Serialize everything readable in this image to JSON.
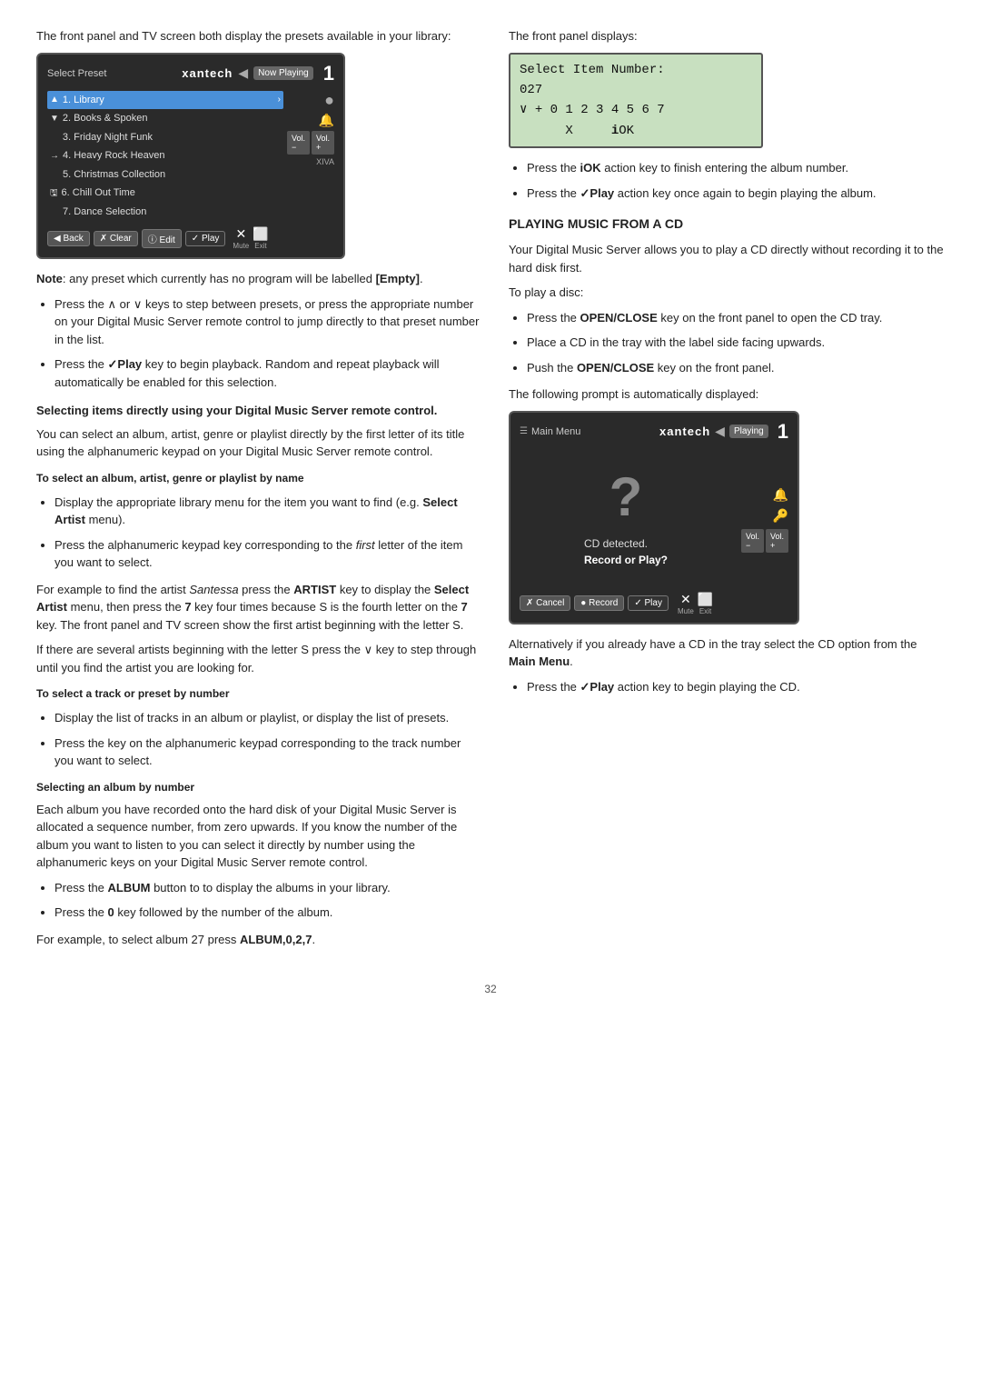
{
  "left_col": {
    "intro_text": "The front panel and TV screen both display the presets available in your library:",
    "screen": {
      "label": "Select Preset",
      "brand": "xantech",
      "now_playing": "Now Playing",
      "big_number": "1",
      "items": [
        {
          "id": 1,
          "name": "Library",
          "selected": true,
          "has_arrow": true,
          "icon": "▲"
        },
        {
          "id": 2,
          "name": "Books & Spoken",
          "selected": false,
          "icon": "▼"
        },
        {
          "id": 3,
          "name": "Friday Night Funk",
          "selected": false,
          "icon": ""
        },
        {
          "id": 4,
          "name": "Heavy Rock Heaven",
          "selected": false,
          "icon": "→"
        },
        {
          "id": 5,
          "name": "Christmas Collection",
          "selected": false,
          "icon": ""
        },
        {
          "id": 6,
          "name": "Chill Out Time",
          "selected": false,
          "icon": "🖫"
        },
        {
          "id": 7,
          "name": "Dance Selection",
          "selected": false,
          "icon": ""
        }
      ],
      "footer_buttons": [
        "◀ Back",
        "✗ Clear",
        "ⓘ Edit",
        "✓ Play"
      ],
      "vol_label1": "Vol.",
      "vol_label2": "Vol.",
      "library_label": "Library",
      "xiva_label": "XIVA",
      "mute_label": "Mute",
      "exit_label": "Exit"
    },
    "note": "Note: any preset which currently has no program will be labelled [Empty].",
    "bullets1": [
      "Press the ∧ or ∨ keys to step between presets, or press the appropriate number on your Digital Music Server remote control to jump directly to that preset number in the list.",
      "Press the ✓Play key to begin playback. Random and repeat playback will automatically be enabled for this selection."
    ],
    "subsection_title": "Selecting items directly using your Digital Music Server remote control.",
    "subsection_text": "You can select an album, artist, genre or playlist directly by the first letter of its title using the alphanumeric keypad on your Digital Music Server remote control.",
    "to_select_label": "To select an album, artist, genre or playlist by name",
    "to_select_bullets": [
      "Display the appropriate library menu for the item you want to find (e.g. Select Artist menu).",
      "Press the alphanumeric keypad key corresponding to the first letter of the item you want to select."
    ],
    "example_text": "For example to find the artist Santessa press the ARTIST key to display the Select Artist menu, then press the 7 key four times because S is the fourth letter on the 7 key. The front panel and TV screen show the first artist beginning with the letter S.",
    "if_several_text": "If there are several artists beginning with the letter S press the ∨ key to step through until you find the artist you are looking for.",
    "to_select_track_label": "To select a track or preset by number",
    "to_select_track_bullets": [
      "Display the list of tracks in an album or playlist, or display the list of presets.",
      "Press the key on the alphanumeric keypad corresponding to the track number you want to select."
    ],
    "selecting_album_label": "Selecting an album by number",
    "selecting_album_text": "Each album you have recorded onto the hard disk of your Digital Music Server is allocated a sequence number, from zero upwards. If you know the number of the album you want to listen to you can select it directly by number using the alphanumeric keys on your Digital Music Server remote control.",
    "album_bullets": [
      "Press the ALBUM button to to display the albums in your library.",
      "Press the 0 key followed by the number of the album."
    ],
    "for_example_text": "For example, to select album 27 press ALBUM,0,2,7."
  },
  "right_col": {
    "front_panel_label": "The front panel displays:",
    "panel_display_line1": "Select Item Number:",
    "panel_display_line2": "027",
    "panel_display_line3": "∨ + 0 1 2 3 4 5 6 7",
    "panel_display_line4": "      X    iOK",
    "bullets_after_panel": [
      "Press the iOK action key to finish entering the album number.",
      "Press the ✓Play action key once again to begin playing the album."
    ],
    "playing_cd_title": "PLAYING MUSIC FROM A CD",
    "playing_cd_text": "Your Digital Music Server allows you to play a CD directly without recording it to the hard disk first.",
    "to_play_label": "To play a disc:",
    "to_play_bullets": [
      "Press the OPEN/CLOSE key on the front panel to open the CD tray.",
      "Place a CD in the tray with the label side facing upwards.",
      "Push the OPEN/CLOSE key on the front panel."
    ],
    "following_prompt_text": "The following prompt is automatically displayed:",
    "cd_screen": {
      "menu_label": "Main Menu",
      "brand": "xantech",
      "playing_badge": "Playing",
      "big_number": "1",
      "cd_detected": "CD detected.",
      "record_or_play": "Record or Play?",
      "footer_buttons": [
        "✗ Cancel",
        "● Record",
        "✓ Play"
      ],
      "vol_label1": "Vol.",
      "vol_label2": "Vol.",
      "mute_label": "Mute",
      "exit_label": "Exit"
    },
    "alternatively_text": "Alternatively if you already have a CD in the tray select the CD option from the Main Menu.",
    "last_bullet": "Press the ✓Play action key to begin playing the CD."
  },
  "page_number": "32"
}
